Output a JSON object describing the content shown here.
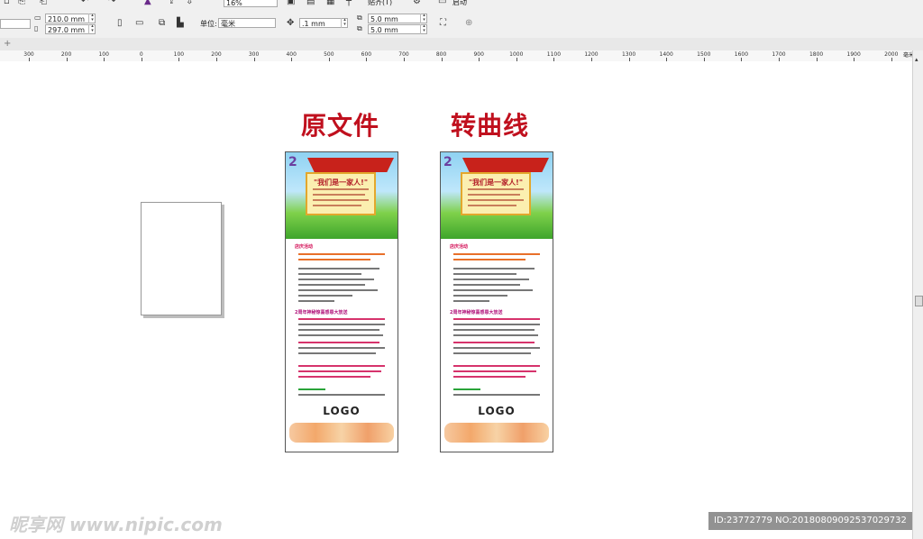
{
  "toolbar": {
    "zoom": "16%",
    "snap_label": "贴齐(T)",
    "launch_label": "启动"
  },
  "property_bar": {
    "width": "210.0 mm",
    "height": "297.0 mm",
    "units_label": "单位:",
    "units_value": "毫米",
    "nudge": ".1 mm",
    "dup_x": "5.0 mm",
    "dup_y": "5.0 mm"
  },
  "ruler": {
    "ticks": [
      "300",
      "200",
      "100",
      "0",
      "100",
      "200",
      "300",
      "400",
      "500",
      "600",
      "700",
      "800",
      "900",
      "1000",
      "1100",
      "1200",
      "1300",
      "1400",
      "1500",
      "1600",
      "1700",
      "1800",
      "1900",
      "2000"
    ],
    "unit": "毫米"
  },
  "canvas": {
    "title_left": "原文件",
    "title_right": "转曲线",
    "accent_color": "#c0101e"
  },
  "flyer": {
    "headline": "\"我们是一家人!\"",
    "section1": "店庆活动",
    "section2": "2周年神秘惊喜感恩大放送",
    "logo": "LOGO"
  },
  "watermark": {
    "text": "昵享网 www.nipic.com",
    "id_text": "ID:23772779 NO:20180809092537029732"
  }
}
